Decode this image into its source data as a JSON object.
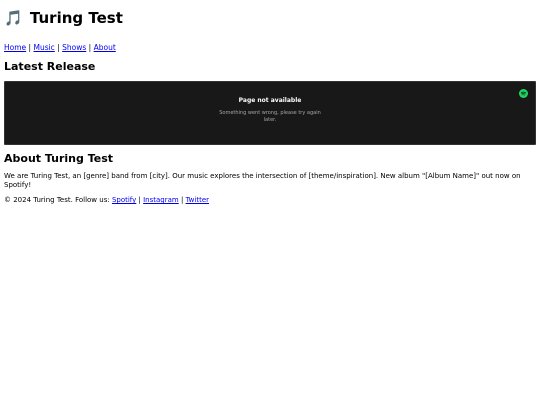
{
  "header": {
    "icon": "🎵",
    "icon_name": "music-note-icon",
    "title": "Turing Test"
  },
  "nav": {
    "items": [
      {
        "label": "Home"
      },
      {
        "label": "Music"
      },
      {
        "label": "Shows"
      },
      {
        "label": "About"
      }
    ],
    "separator": "|"
  },
  "latest_release": {
    "heading": "Latest Release",
    "embed": {
      "title": "Page not available",
      "message": "Something went wrong, please try again later.",
      "logo": "spotify-icon",
      "background": "#181818",
      "logo_color": "#1ed760"
    }
  },
  "about": {
    "heading": "About Turing Test",
    "body": "We are Turing Test, an [genre] band from [city]. Our music explores the intersection of [theme/inspiration]. New album \"[Album Name]\" out now on Spotify!"
  },
  "footer": {
    "prefix": "© 2024 Turing Test. Follow us:",
    "links": [
      {
        "label": "Spotify"
      },
      {
        "label": "Instagram"
      },
      {
        "label": "Twitter"
      }
    ],
    "separator": "|"
  }
}
